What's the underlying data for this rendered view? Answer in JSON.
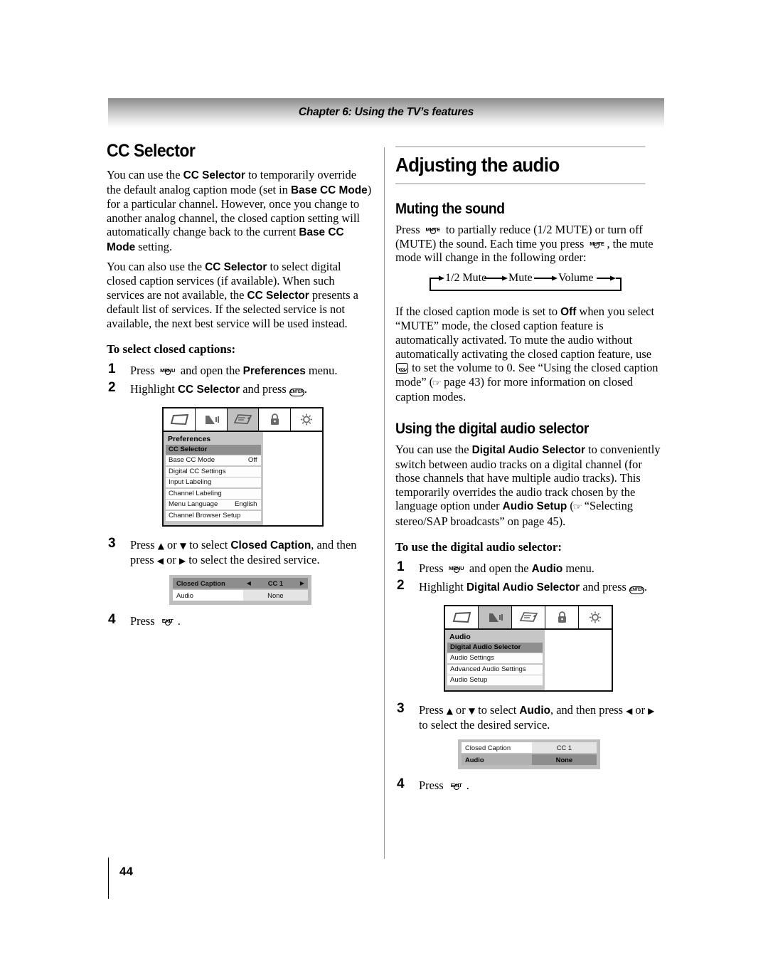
{
  "header": {
    "chapter_title": "Chapter 6: Using the TV’s features"
  },
  "page_number": "44",
  "left_column": {
    "heading": "CC Selector",
    "paragraphs": [
      {
        "runs": [
          {
            "t": "You can use the ",
            "s": "n"
          },
          {
            "t": "CC Selector",
            "s": "b"
          },
          {
            "t": " to temporarily override the default analog caption mode (set in ",
            "s": "n"
          },
          {
            "t": "Base CC Mode",
            "s": "b"
          },
          {
            "t": ") for a particular channel. However, once you change to another analog channel, the closed caption setting will automatically change back to the current ",
            "s": "n"
          },
          {
            "t": "Base CC Mode",
            "s": "b"
          },
          {
            "t": " setting.",
            "s": "n"
          }
        ]
      },
      {
        "runs": [
          {
            "t": "You can also use the ",
            "s": "n"
          },
          {
            "t": "CC Selector",
            "s": "b"
          },
          {
            "t": " to select digital closed caption services (if available). When such services are not available, the ",
            "s": "n"
          },
          {
            "t": "CC Selector",
            "s": "b"
          },
          {
            "t": " presents a default list of services. If the selected service is not available, the next best service will be used instead.",
            "s": "n"
          }
        ]
      }
    ],
    "procedure_heading": "To select closed captions:",
    "steps": [
      {
        "num": "1",
        "parts": [
          "Press ",
          "MENU_KEY",
          " and open the ",
          "Preferences",
          " menu."
        ]
      },
      {
        "num": "2",
        "parts": [
          "Highlight ",
          "CC Selector",
          " and press ",
          "ENTER_KEY",
          "."
        ]
      },
      {
        "num": "3",
        "parts": [
          "Press ",
          "UP",
          " or ",
          "DOWN",
          " to select ",
          "Closed Caption",
          ", and then press ",
          "LEFT",
          " or ",
          "RIGHT",
          " to select the desired service."
        ]
      },
      {
        "num": "4",
        "parts": [
          "Press ",
          "EXIT_KEY",
          "."
        ]
      }
    ],
    "step1_text_pre": "Press ",
    "step1_text_mid": " and open the ",
    "step1_bold": "Preferences",
    "step1_text_post": " menu.",
    "step2_text_pre": "Highlight ",
    "step2_bold": "CC Selector",
    "step2_text_mid": " and press ",
    "step2_text_post": ".",
    "step3_text_pre": "Press ",
    "step3_text_a": " or ",
    "step3_text_b": " to select ",
    "step3_bold": "Closed Caption",
    "step3_text_c": ", and then press ",
    "step3_text_d": " or ",
    "step3_text_e": " to select the desired service.",
    "step4_text_pre": "Press ",
    "step4_text_post": "."
  },
  "preferences_menu": {
    "icons": [
      "picture-icon",
      "audio-icon",
      "preferences-icon",
      "lock-icon",
      "setup-icon"
    ],
    "selected_icon_index": 2,
    "title": "Preferences",
    "rows": [
      {
        "label": "CC Selector",
        "value": "",
        "highlighted": true
      },
      {
        "label": "Base CC Mode",
        "value": "Off",
        "highlighted": false
      },
      {
        "label": "Digital CC Settings",
        "value": "",
        "highlighted": false
      },
      {
        "label": "Input Labeling",
        "value": "",
        "highlighted": false
      },
      {
        "label": "Channel Labeling",
        "value": "",
        "highlighted": false
      },
      {
        "label": "Menu Language",
        "value": "English",
        "highlighted": false
      },
      {
        "label": "Channel Browser Setup",
        "value": "",
        "highlighted": false
      }
    ]
  },
  "cc_dialog_left": {
    "rows": [
      {
        "label": "Closed Caption",
        "value": "CC 1",
        "selected": true,
        "arrows": true
      },
      {
        "label": "Audio",
        "value": "None",
        "selected": false,
        "arrows": false
      }
    ]
  },
  "right_column": {
    "big_heading": "Adjusting the audio",
    "mute_section": {
      "heading": "Muting the sound",
      "para1_pre": "Press ",
      "para1_a": " to partially reduce (1/2 MUTE) or turn off (MUTE) the sound. Each time you press ",
      "para1_b": ", the mute mode will change in the following order:",
      "flow": [
        "1/2 Mute",
        "Mute",
        "Volume"
      ],
      "para2_pre": "If the closed caption mode is set to ",
      "para2_bold": "Off",
      "para2_mid": " when you select “MUTE” mode, the closed caption feature is automatically activated. To mute the audio without automatically activating the closed caption feature, use ",
      "para2_post": " to set the volume to 0. See “Using the closed caption mode” (",
      "para2_page": " page 43) for more information on closed caption modes."
    },
    "das_section": {
      "heading": "Using the digital audio selector",
      "para_pre": "You can use the ",
      "para_bold1": "Digital Audio Selector",
      "para_mid": " to conveniently switch between audio tracks on a digital channel (for those channels that have multiple audio tracks). This temporarily overrides the audio track chosen by the language option under ",
      "para_bold2": "Audio Setup",
      "para_post": " (",
      "para_end": " “Selecting stereo/SAP broadcasts” on page 45).",
      "procedure_heading": "To use the digital audio selector:",
      "step1_pre": "Press ",
      "step1_mid": " and open the ",
      "step1_bold": "Audio",
      "step1_post": " menu.",
      "step2_pre": "Highlight ",
      "step2_bold": "Digital Audio Selector",
      "step2_mid": " and press ",
      "step2_post": ".",
      "step3_pre": "Press ",
      "step3_a": " or ",
      "step3_b": " to select ",
      "step3_bold": "Audio",
      "step3_c": ", and then press ",
      "step3_d": " or ",
      "step3_e": " to select the desired service.",
      "step4_pre": "Press ",
      "step4_post": "."
    }
  },
  "audio_menu": {
    "icons": [
      "picture-icon",
      "audio-icon",
      "preferences-icon",
      "lock-icon",
      "setup-icon"
    ],
    "selected_icon_index": 1,
    "title": "Audio",
    "rows": [
      {
        "label": "Digital Audio Selector",
        "value": "",
        "highlighted": true
      },
      {
        "label": "Audio Settings",
        "value": "",
        "highlighted": false
      },
      {
        "label": "Advanced Audio Settings",
        "value": "",
        "highlighted": false
      },
      {
        "label": "Audio Setup",
        "value": "",
        "highlighted": false
      }
    ]
  },
  "cc_dialog_right": {
    "rows": [
      {
        "label": "Closed Caption",
        "value": "CC 1",
        "selected": false
      },
      {
        "label": "Audio",
        "value": "None",
        "selected": true
      }
    ]
  },
  "step_numbers": {
    "s1": "1",
    "s2": "2",
    "s3": "3",
    "s4": "4"
  },
  "glyphs": {
    "menu": "MENU",
    "mute": "MUTE",
    "exit": "EXIT",
    "enter": "ENTER",
    "vol": "VOL",
    "up": "▲",
    "down": "▼",
    "left": "◀",
    "right": "▶",
    "hand": "☞"
  },
  "colors": {
    "osd_body": "#c6c6c6",
    "osd_highlight": "#8f8f8f",
    "rule": "#c8c8c8"
  }
}
